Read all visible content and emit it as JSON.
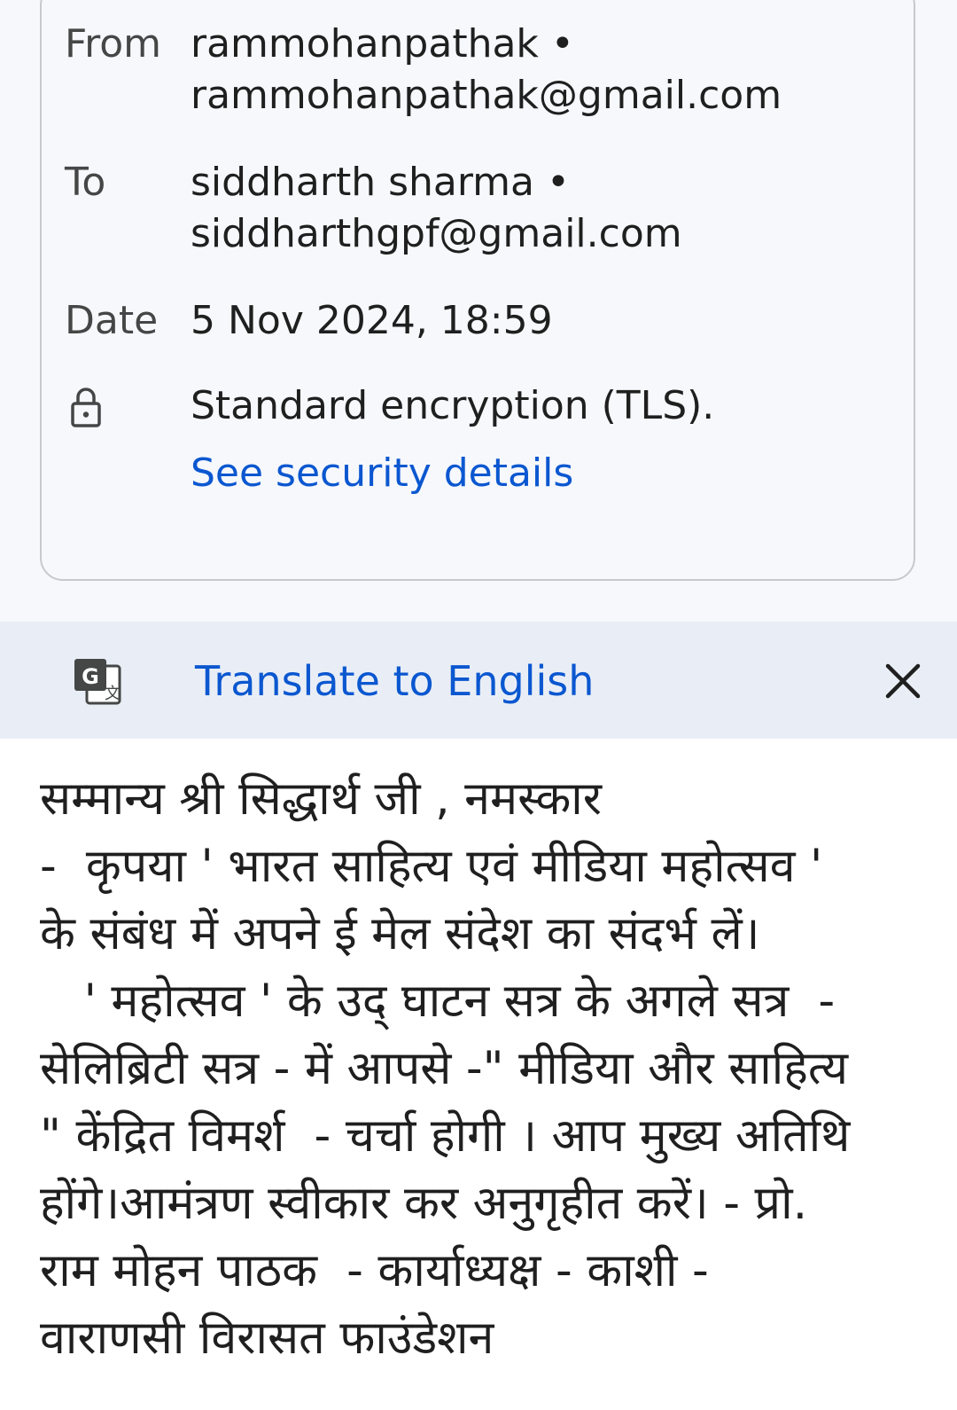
{
  "header": {
    "from_label": "From",
    "from_name": "rammohanpathak •",
    "from_email": "rammohanpathak@gmail.com",
    "to_label": "To",
    "to_name": "siddharth sharma •",
    "to_email": "siddharthgpf@gmail.com",
    "date_label": "Date",
    "date_value": "5 Nov 2024, 18:59",
    "encryption_icon": "lock-icon",
    "encryption_text": "Standard encryption (TLS).",
    "security_link": "See security details"
  },
  "translate_bar": {
    "icon": "google-translate-icon",
    "label": "Translate to English",
    "close_icon": "close-icon"
  },
  "message": {
    "lines": [
      "सम्मान्य श्री सिद्धार्थ जी , नमस्कार",
      "-  कृपया ' भारत साहित्य एवं मीडिया महोत्सव '",
      "के संबंध में अपने ई मेल संदेश का संदर्भ लें।",
      "   ' महोत्सव ' के उद् घाटन सत्र के अगले सत्र  -",
      "सेलिब्रिटी सत्र - में आपसे -\" मीडिया और साहित्य",
      "\" केंद्रित विमर्श  - चर्चा होगी । आप मुख्य अतिथि",
      "होंगे।आमंत्रण स्वीकार कर अनुगृहीत करें। - प्रो.",
      "राम मोहन पाठक  - कार्याध्यक्ष - काशी -",
      "वाराणसी विरासत फाउंडेशन"
    ]
  },
  "colors": {
    "link": "#0b57d0",
    "translate_bar_bg": "#e9eef6",
    "card_border": "#c7c9cc",
    "page_bg": "#f6f8fc"
  }
}
